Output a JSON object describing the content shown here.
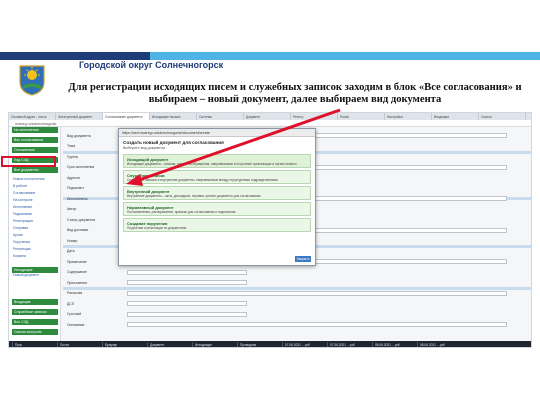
{
  "header": {
    "org_title": "Городской округ Солнечногорск",
    "caption": "Для регистрации исходящих писем и служебных записок заходим в блок «Все согласования» и выбираем – новый документ, далее выбираем вид документа"
  },
  "browser": {
    "tabs": [
      "Основной адрес - почта",
      "Электронный документ",
      "Согласование документа",
      "Исходящее письмо",
      "Система",
      "Документ",
      "Реестр",
      "Поиск",
      "Настройки",
      "Входящие",
      "Список"
    ],
    "address": "mosreg.ru/solnechnogorsk"
  },
  "sidebar": {
    "green_items": [
      "На исполнении",
      "Все согласования",
      "Отложенные",
      "Ход СЭД",
      "Все документы",
      "Исходящие",
      "Входящие",
      "Служебные записки",
      "Все СЭД",
      "Списки контроля"
    ],
    "links": [
      "Новые поступления",
      "В работе",
      "Согласование",
      "На контроле",
      "Исполнение",
      "Подписание",
      "Регистрация",
      "Отправка",
      "Архив",
      "Поручения",
      "Резолюции",
      "Корзина",
      "Новый документ"
    ],
    "highlighted_link": "Новый документ"
  },
  "form": {
    "labels": [
      "Вид документа",
      "Тема",
      "Группа",
      "Срок исполнения",
      "Адресат",
      "Подписант",
      "Исполнитель",
      "Автор",
      "Статус документа",
      "Вид доставки",
      "Номер",
      "Дата",
      "Примечание",
      "Содержание",
      "Приложения",
      "Рассылка",
      "ДСП",
      "Срочный",
      "Основание"
    ]
  },
  "modal": {
    "bar_text": "https://sed.mosreg.ru/solnechnogorsk/document/create",
    "title": "Создать новый документ для согласования",
    "subtitle": "Выберите вид документа",
    "options": [
      {
        "title": "Исходящий документ",
        "desc": "Исходящие документы – письма, ответы на обращения, направляемые в сторонние организации и органы власти."
      },
      {
        "title": "Служебная записка",
        "desc": "Служебные записки и внутренние документы, направляемые между структурными подразделениями."
      },
      {
        "title": "Внутренний документ",
        "desc": "Внутренние документы – акты, докладные, справки, прочие документы для согласования."
      },
      {
        "title": "Нормативный документ",
        "desc": "Постановления, распоряжения, приказы для согласования и подписания."
      },
      {
        "title": "Создание поручения",
        "desc": "Поручения и резолюции по документам."
      }
    ],
    "close_label": "Закрыть"
  },
  "taskbar": {
    "items": [
      "Пуск",
      "Почта",
      "Браузер",
      "Документ",
      "Исходящие",
      "Проводник",
      "07.06.2021 …pdf",
      "07.06.2021 …pdf",
      "08.06.2021 …pdf",
      "08.06.2021 …pdf"
    ]
  },
  "colors": {
    "header_dark": "#1f3c78",
    "header_light": "#4fb3e6",
    "sidebar_green": "#2e8b3e",
    "highlight_red": "#e0102a"
  }
}
